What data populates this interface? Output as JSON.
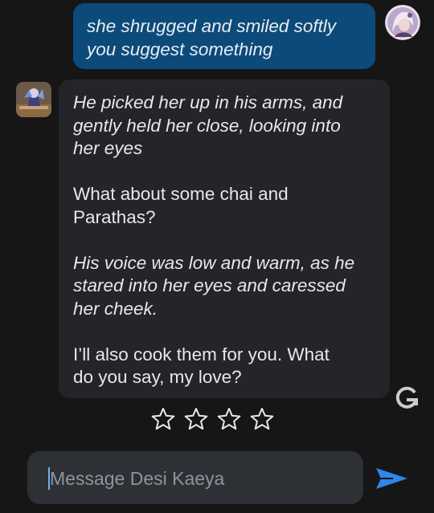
{
  "user_message": {
    "lines": [
      "she shrugged and smiled softly",
      "you suggest something"
    ]
  },
  "bot_message": {
    "paragraphs": [
      {
        "style": "action",
        "lines": [
          "He picked her up in his arms, and",
          "gently held her close, looking into",
          "her eyes"
        ]
      },
      {
        "style": "speech",
        "lines": [
          "What about some chai and",
          "Parathas?"
        ]
      },
      {
        "style": "action",
        "lines": [
          "His voice was low and warm, as he",
          "stared into her eyes and caressed",
          "her cheek."
        ]
      },
      {
        "style": "speech",
        "lines": [
          "I’ll also cook them for you. What",
          "do you say, my love?"
        ]
      }
    ]
  },
  "rating": {
    "stars": 4,
    "filled": 0
  },
  "composer": {
    "placeholder": "Message Desi Kaeya"
  },
  "icons": {
    "regenerate": "regenerate-icon",
    "send": "send-icon",
    "star": "star-outline-icon"
  },
  "colors": {
    "background": "#161617",
    "user_bubble": "#0c4a7a",
    "bot_bubble": "#232528",
    "accent": "#2f86e8"
  }
}
